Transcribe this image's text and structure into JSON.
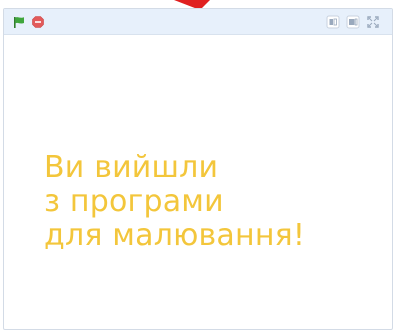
{
  "stage": {
    "message_lines": [
      "Ви вийшли",
      "з програми",
      "для малювання!"
    ]
  },
  "icons": {
    "green_flag": "green-flag-icon",
    "stop": "stop-icon",
    "small_stage": "small-stage-icon",
    "normal_stage": "normal-stage-icon",
    "fullscreen": "fullscreen-icon"
  },
  "colors": {
    "message": "#f3c63b",
    "toolbar": "#e7f0fb",
    "green_flag": "#3fa63c",
    "stop": "#e25a5a",
    "annotation_arrow": "#e02020"
  }
}
